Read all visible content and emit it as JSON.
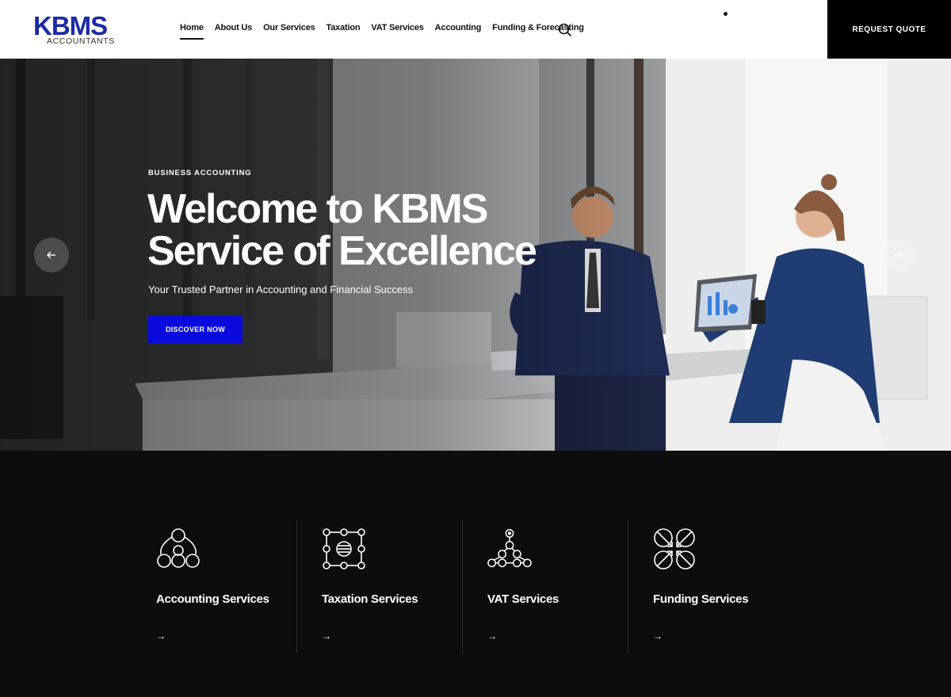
{
  "header": {
    "logo_mark": "KBMS",
    "logo_sub": "ACCOUNTANTS",
    "nav": [
      {
        "label": "Home"
      },
      {
        "label": "About Us"
      },
      {
        "label": "Our Services"
      },
      {
        "label": "Taxation"
      },
      {
        "label": "VAT Services"
      },
      {
        "label": "Accounting"
      },
      {
        "label": "Funding & Forecasting"
      }
    ],
    "active_nav": "Home",
    "search_icon": "search-icon",
    "quote_label": "REQUEST QUOTE"
  },
  "hero": {
    "eyebrow": "BUSINESS ACCOUNTING",
    "headline_line1": "Welcome to KBMS",
    "headline_line2": "Service of Excellence",
    "subline": "Your Trusted Partner in Accounting and Financial Success",
    "cta_label": "DISCOVER NOW",
    "prev_icon": "arrow-left-icon",
    "next_icon": "arrow-right-icon"
  },
  "services": [
    {
      "title": "Accounting Services",
      "icon": "circles-cluster-icon"
    },
    {
      "title": "Taxation Services",
      "icon": "nodes-grid-icon"
    },
    {
      "title": "VAT Services",
      "icon": "network-tree-icon"
    },
    {
      "title": "Funding Services",
      "icon": "arrows-converge-icon"
    }
  ],
  "colors": {
    "accent_blue": "#0a0adf",
    "logo_blue": "#1b2aa6",
    "quote_bg": "#000000",
    "services_bg": "#0d0d0d"
  }
}
